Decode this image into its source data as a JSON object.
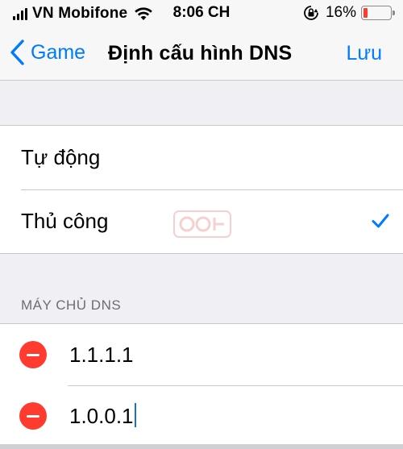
{
  "status_bar": {
    "carrier": "VN Mobifone",
    "time": "8:06 CH",
    "battery_percent": "16%",
    "battery_level": 0.16,
    "battery_color": "#ff3b30",
    "icons": [
      "signal-icon",
      "wifi-icon",
      "orientation-lock-icon",
      "battery-icon"
    ]
  },
  "nav": {
    "back_label": "Game",
    "title": "Định cấu hình DNS",
    "save_label": "Lưu",
    "accent_color": "#007aff"
  },
  "config": {
    "options": [
      {
        "label": "Tự động",
        "selected": false
      },
      {
        "label": "Thủ công",
        "selected": true
      }
    ]
  },
  "dns": {
    "section_title": "MÁY CHỦ DNS",
    "servers": [
      "1.1.1.1",
      "1.0.0.1"
    ]
  }
}
